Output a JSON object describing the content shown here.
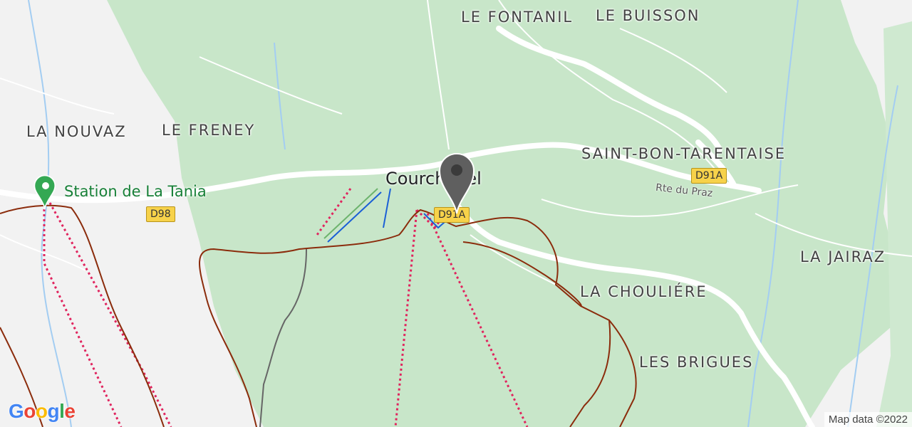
{
  "map": {
    "colors": {
      "forest": "#c8e6c9",
      "land": "#f2f2f2",
      "road": "#ffffff",
      "lift": "#e0245e",
      "piste": "#8b2c0c",
      "river": "#a3cdf2",
      "shield": "#f7d24a"
    },
    "place_labels": [
      {
        "id": "le-fontanil",
        "text": "LE FONTANIL"
      },
      {
        "id": "le-buisson",
        "text": "LE BUISSON"
      },
      {
        "id": "la-nouvaz",
        "text": "LA NOUVAZ"
      },
      {
        "id": "le-freney",
        "text": "LE FRENEY"
      },
      {
        "id": "saint-bon-tarentaise",
        "text": "SAINT-BON-TARENTAISE"
      },
      {
        "id": "la-jairaz",
        "text": "LA JAIRAZ"
      },
      {
        "id": "la-chouliere",
        "text": "LA CHOULIÉRE"
      },
      {
        "id": "les-brigues",
        "text": "LES BRIGUES"
      }
    ],
    "town_label": "Courchevel",
    "road_label": "Rte du Praz",
    "road_shields": [
      "D98",
      "D91A",
      "D91A"
    ],
    "station_label": "Station de La Tania",
    "marker_icon": "map-pin-icon",
    "station_icon": "green-pin-icon"
  },
  "footer": {
    "logo_letters": [
      "G",
      "o",
      "o",
      "g",
      "l",
      "e"
    ],
    "attribution": "Map data ©2022"
  }
}
